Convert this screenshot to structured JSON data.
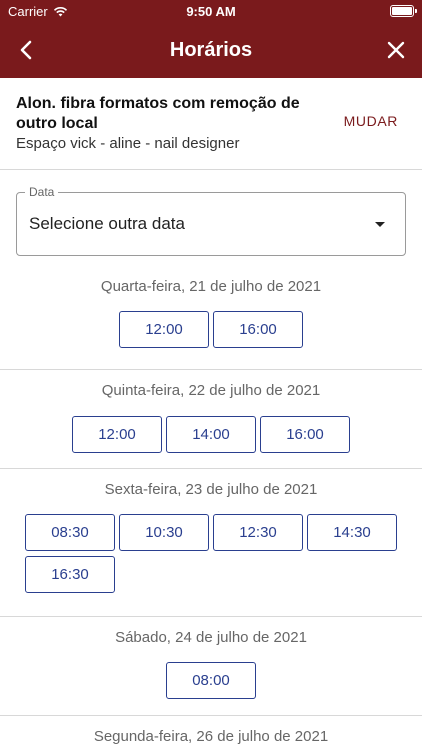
{
  "status_bar": {
    "carrier": "Carrier",
    "time": "9:50 AM"
  },
  "navbar": {
    "title": "Horários"
  },
  "service": {
    "name": "Alon. fibra formatos com remoção de outro local",
    "vendor": "Espaço vick - aline - nail designer",
    "change_label": "MUDAR"
  },
  "date_field": {
    "label": "Data",
    "value": "Selecione outra data"
  },
  "days": [
    {
      "label": "Quarta-feira, 21 de julho de 2021",
      "slots": [
        "12:00",
        "16:00"
      ]
    },
    {
      "label": "Quinta-feira, 22 de julho de 2021",
      "slots": [
        "12:00",
        "14:00",
        "16:00"
      ]
    },
    {
      "label": "Sexta-feira, 23 de julho de 2021",
      "slots": [
        "08:30",
        "10:30",
        "12:30",
        "14:30",
        "16:30"
      ]
    },
    {
      "label": "Sábado, 24 de julho de 2021",
      "slots": [
        "08:00"
      ]
    },
    {
      "label": "Segunda-feira, 26 de julho de 2021",
      "slots": []
    }
  ],
  "colors": {
    "brand": "#7a1a1c",
    "slot_accent": "#2a3f8f"
  },
  "icons": {
    "back": "chevron-left-icon",
    "close": "close-icon",
    "wifi": "wifi-icon",
    "battery": "battery-icon",
    "dropdown": "caret-down-icon"
  }
}
